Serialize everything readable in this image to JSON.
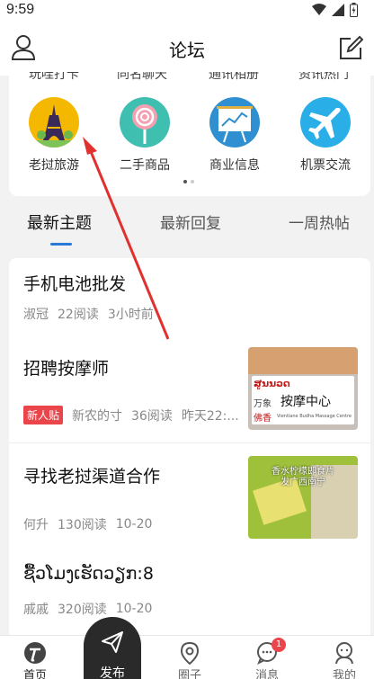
{
  "status": {
    "time": "9:59"
  },
  "header": {
    "title": "论坛"
  },
  "categories": {
    "partial_row": [
      "玩哇打卡",
      "同名聊天",
      "通讯相册",
      "资讯热门"
    ],
    "items": [
      {
        "label": "老挝旅游",
        "icon": "eiffel-tower-icon"
      },
      {
        "label": "二手商品",
        "icon": "lollipop-icon"
      },
      {
        "label": "商业信息",
        "icon": "chart-board-icon"
      },
      {
        "label": "机票交流",
        "icon": "airplane-icon"
      }
    ],
    "page_index": 1,
    "page_count": 2
  },
  "tabs": [
    "最新主题",
    "最新回复",
    "一周热帖"
  ],
  "posts": [
    {
      "title": "手机电池批发",
      "author": "淑冠",
      "reads": "22阅读",
      "time": "3小时前"
    },
    {
      "title": "招聘按摩师",
      "badge": "新人贴",
      "author": "新农的寸",
      "reads": "36阅读",
      "time": "昨天22:...",
      "thumb_text": {
        "line1": "ສູນນວດ",
        "line2": "按摩中心",
        "line3": "万象",
        "line4": "佛香",
        "line5": "Vientiane Budha Massage Centre"
      }
    },
    {
      "title": "寻找老挝渠道合作",
      "author": "何升",
      "reads": "130阅读",
      "time": "10-20",
      "thumb_text": {
        "line1": "香水柠檬即食片",
        "line2": "发广西南宁"
      }
    },
    {
      "title": "ຊື້ວໂມງເຮັດວຽກ:8",
      "author": "戚戚",
      "reads": "320阅读",
      "time": "10-20"
    }
  ],
  "tabbar": {
    "home": "首页",
    "publish": "发布",
    "circle": "圈子",
    "messages": "消息",
    "messages_badge": "1",
    "mine": "我的"
  },
  "colors": {
    "accent": "#2979d8",
    "badge": "#e9454a",
    "arrow": "#e0312f"
  }
}
